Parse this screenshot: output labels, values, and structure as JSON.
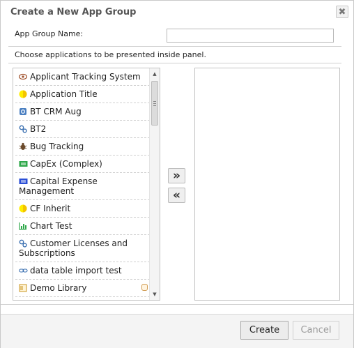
{
  "dialog": {
    "title": "Create a New App Group",
    "close_label": "✖"
  },
  "form": {
    "name_label": "App Group Name:",
    "name_value": "",
    "choose_label": "Choose applications to be presented inside panel."
  },
  "app_list": [
    {
      "label": "Applicant Tracking System",
      "icon": "eye-icon"
    },
    {
      "label": "Application Title",
      "icon": "half-circle-icon"
    },
    {
      "label": "BT CRM Aug",
      "icon": "settings-box-icon"
    },
    {
      "label": "BT2",
      "icon": "gears-icon"
    },
    {
      "label": "Bug Tracking",
      "icon": "bug-icon"
    },
    {
      "label": "CapEx (Complex)",
      "icon": "money-icon"
    },
    {
      "label": "Capital Expense Management",
      "icon": "money-blue-icon"
    },
    {
      "label": "CF Inherit",
      "icon": "half-circle-icon"
    },
    {
      "label": "Chart Test",
      "icon": "bar-chart-icon"
    },
    {
      "label": "Customer Licenses and Subscriptions",
      "icon": "gears-icon"
    },
    {
      "label": "data table import test",
      "icon": "link-icon"
    },
    {
      "label": "Demo Library",
      "icon": "library-icon"
    }
  ],
  "move_buttons": {
    "add": "»",
    "remove": "«"
  },
  "footer": {
    "create_label": "Create",
    "cancel_label": "Cancel"
  },
  "colors": {
    "create_button_bg": "#ececec",
    "cancel_text_disabled": "#9a9a9a",
    "border": "#c3c3c3"
  }
}
